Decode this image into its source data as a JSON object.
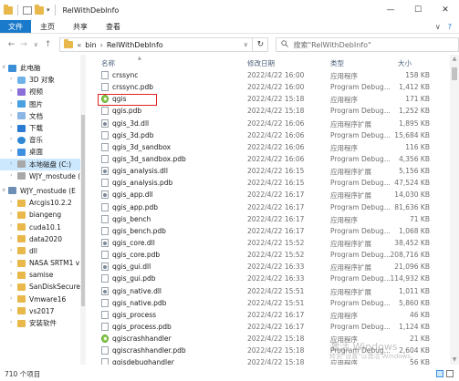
{
  "window": {
    "title": "RelWithDebInfo",
    "controls": {
      "minimize": "—",
      "maximize": "☐",
      "close": "✕"
    }
  },
  "ribbon": {
    "tabs": [
      "文件",
      "主页",
      "共享",
      "查看"
    ],
    "collapse_icon": "∨",
    "help_icon": "?"
  },
  "address": {
    "back": "←",
    "forward": "→",
    "dropdown": "∨",
    "up": "↑",
    "prefix": "«",
    "crumbs": [
      "bin",
      "RelWithDebInfo"
    ],
    "separator": "›",
    "refresh": "↻",
    "search_placeholder": "搜索\"RelWithDebInfo\""
  },
  "sidebar": {
    "items": [
      {
        "label": "此电脑",
        "icon": "pc-icon",
        "indent": 0,
        "expander": ""
      },
      {
        "label": "3D 对象",
        "icon": "3d-objects-icon",
        "indent": 1
      },
      {
        "label": "视频",
        "icon": "video-icon",
        "indent": 1
      },
      {
        "label": "图片",
        "icon": "pictures-icon",
        "indent": 1
      },
      {
        "label": "文档",
        "icon": "documents-icon",
        "indent": 1
      },
      {
        "label": "下载",
        "icon": "download-icon",
        "indent": 1
      },
      {
        "label": "音乐",
        "icon": "music-icon",
        "indent": 1
      },
      {
        "label": "桌面",
        "icon": "desktop-icon",
        "indent": 1
      },
      {
        "label": "本地磁盘 (C:)",
        "icon": "drive-icon",
        "indent": 1,
        "selected": true
      },
      {
        "label": "WJY_mostude (",
        "icon": "drive-icon",
        "indent": 1
      },
      {
        "label": "WJY_mostude (E",
        "icon": "network-drive-icon",
        "indent": 0
      },
      {
        "label": "Arcgis10.2.2",
        "icon": "folder-icon",
        "indent": 1
      },
      {
        "label": "biangeng",
        "icon": "folder-icon",
        "indent": 1
      },
      {
        "label": "cuda10.1",
        "icon": "folder-icon",
        "indent": 1
      },
      {
        "label": "data2020",
        "icon": "folder-icon",
        "indent": 1
      },
      {
        "label": "dll",
        "icon": "folder-icon",
        "indent": 1
      },
      {
        "label": "NASA SRTM1 v",
        "icon": "folder-icon",
        "indent": 1
      },
      {
        "label": "samise",
        "icon": "folder-icon",
        "indent": 1
      },
      {
        "label": "SanDiskSecure",
        "icon": "folder-icon",
        "indent": 1
      },
      {
        "label": "Vmware16",
        "icon": "folder-icon",
        "indent": 1
      },
      {
        "label": "vs2017",
        "icon": "folder-icon",
        "indent": 1
      },
      {
        "label": "安装软件",
        "icon": "folder-icon",
        "indent": 1
      }
    ]
  },
  "columns": {
    "name": "名称",
    "date": "修改日期",
    "type": "类型",
    "size": "大小"
  },
  "files": [
    {
      "name": "crssync",
      "date": "2022/4/22 16:00",
      "type": "应用程序",
      "size": "158 KB",
      "icon": "file-icon"
    },
    {
      "name": "crssync.pdb",
      "date": "2022/4/22 16:00",
      "type": "Program Debug...",
      "size": "1,412 KB",
      "icon": "file-icon"
    },
    {
      "name": "qgis",
      "date": "2022/4/22 15:18",
      "type": "应用程序",
      "size": "171 KB",
      "icon": "qgis-icon",
      "highlighted": true
    },
    {
      "name": "qgis.pdb",
      "date": "2022/4/22 15:18",
      "type": "Program Debug...",
      "size": "1,252 KB",
      "icon": "file-icon"
    },
    {
      "name": "qgis_3d.dll",
      "date": "2022/4/22 16:06",
      "type": "应用程序扩展",
      "size": "1,895 KB",
      "icon": "dll-icon"
    },
    {
      "name": "qgis_3d.pdb",
      "date": "2022/4/22 16:06",
      "type": "Program Debug...",
      "size": "15,684 KB",
      "icon": "file-icon"
    },
    {
      "name": "qgis_3d_sandbox",
      "date": "2022/4/22 16:06",
      "type": "应用程序",
      "size": "116 KB",
      "icon": "file-icon"
    },
    {
      "name": "qgis_3d_sandbox.pdb",
      "date": "2022/4/22 16:06",
      "type": "Program Debug...",
      "size": "4,356 KB",
      "icon": "file-icon"
    },
    {
      "name": "qgis_analysis.dll",
      "date": "2022/4/22 16:15",
      "type": "应用程序扩展",
      "size": "5,156 KB",
      "icon": "dll-icon"
    },
    {
      "name": "qgis_analysis.pdb",
      "date": "2022/4/22 16:15",
      "type": "Program Debug...",
      "size": "47,524 KB",
      "icon": "file-icon"
    },
    {
      "name": "qgis_app.dll",
      "date": "2022/4/22 16:17",
      "type": "应用程序扩展",
      "size": "14,030 KB",
      "icon": "dll-icon"
    },
    {
      "name": "qgis_app.pdb",
      "date": "2022/4/22 16:17",
      "type": "Program Debug...",
      "size": "81,636 KB",
      "icon": "file-icon"
    },
    {
      "name": "qgis_bench",
      "date": "2022/4/22 16:17",
      "type": "应用程序",
      "size": "71 KB",
      "icon": "file-icon"
    },
    {
      "name": "qgis_bench.pdb",
      "date": "2022/4/22 16:17",
      "type": "Program Debug...",
      "size": "1,068 KB",
      "icon": "file-icon"
    },
    {
      "name": "qgis_core.dll",
      "date": "2022/4/22 15:52",
      "type": "应用程序扩展",
      "size": "38,452 KB",
      "icon": "dll-icon"
    },
    {
      "name": "qgis_core.pdb",
      "date": "2022/4/22 15:52",
      "type": "Program Debug...",
      "size": "208,716 KB",
      "icon": "file-icon"
    },
    {
      "name": "qgis_gui.dll",
      "date": "2022/4/22 16:33",
      "type": "应用程序扩展",
      "size": "21,096 KB",
      "icon": "dll-icon"
    },
    {
      "name": "qgis_gui.pdb",
      "date": "2022/4/22 16:33",
      "type": "Program Debug...",
      "size": "114,932 KB",
      "icon": "file-icon"
    },
    {
      "name": "qgis_native.dll",
      "date": "2022/4/22 15:51",
      "type": "应用程序扩展",
      "size": "1,011 KB",
      "icon": "dll-icon"
    },
    {
      "name": "qgis_native.pdb",
      "date": "2022/4/22 15:51",
      "type": "Program Debug...",
      "size": "5,860 KB",
      "icon": "file-icon"
    },
    {
      "name": "qgis_process",
      "date": "2022/4/22 16:17",
      "type": "应用程序",
      "size": "46 KB",
      "icon": "file-icon"
    },
    {
      "name": "qgis_process.pdb",
      "date": "2022/4/22 16:17",
      "type": "Program Debug...",
      "size": "1,124 KB",
      "icon": "file-icon"
    },
    {
      "name": "qgiscrashhandler",
      "date": "2022/4/22 15:18",
      "type": "应用程序",
      "size": "21 KB",
      "icon": "crash-handler-icon"
    },
    {
      "name": "qgiscrashhandler.pdb",
      "date": "2022/4/22 15:18",
      "type": "Program Debug...",
      "size": "2,604 KB",
      "icon": "file-icon"
    },
    {
      "name": "qgisdebughandler",
      "date": "2022/4/22 15:18",
      "type": "应用程序",
      "size": "56 KB",
      "icon": "file-icon"
    }
  ],
  "watermark": {
    "line1": "激活 Windows",
    "line2": "转到\"设置\"以激活 Windows。"
  },
  "status": {
    "count": "710 个项目"
  }
}
